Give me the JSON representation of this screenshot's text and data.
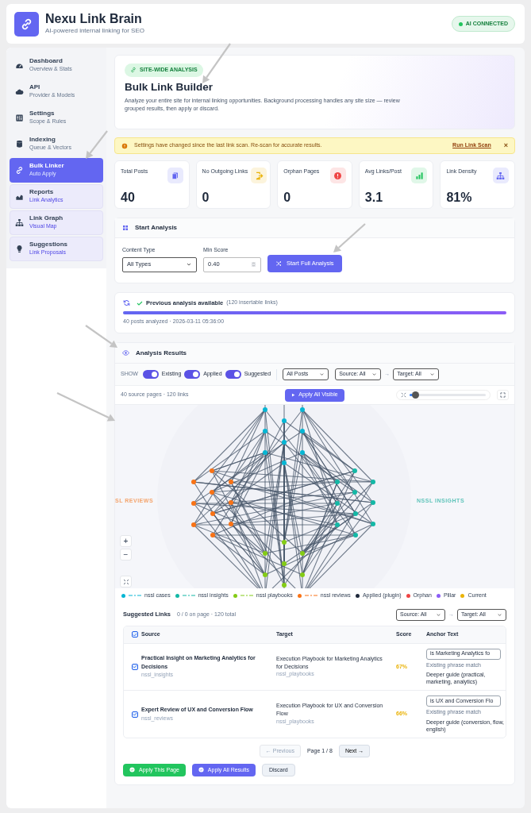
{
  "header": {
    "title": "Nexu Link Brain",
    "subtitle": "AI-powered internal linking for SEO",
    "status": "AI CONNECTED"
  },
  "sidebar": {
    "items": [
      {
        "kind": "gauge",
        "title": "Dashboard",
        "subtitle": "Overview & Stats",
        "selected": false,
        "tinted": false
      },
      {
        "kind": "cloud",
        "title": "API",
        "subtitle": "Provider & Models",
        "selected": false,
        "tinted": false
      },
      {
        "kind": "sliders",
        "title": "Settings",
        "subtitle": "Scope & Rules",
        "selected": false,
        "tinted": false
      },
      {
        "kind": "database",
        "title": "Indexing",
        "subtitle": "Queue & Vectors",
        "selected": false,
        "tinted": false
      },
      {
        "kind": "link",
        "title": "Bulk Linker",
        "subtitle": "Auto Apply",
        "selected": true,
        "tinted": false
      },
      {
        "kind": "chart",
        "title": "Reports",
        "subtitle": "Link Analytics",
        "selected": false,
        "tinted": true
      },
      {
        "kind": "sitemap",
        "title": "Link Graph",
        "subtitle": "Visual Map",
        "selected": false,
        "tinted": true
      },
      {
        "kind": "bulb",
        "title": "Suggestions",
        "subtitle": "Link Proposals",
        "selected": false,
        "tinted": true
      }
    ]
  },
  "hero": {
    "badge": "SITE-WIDE ANALYSIS",
    "title": "Bulk Link Builder",
    "description": "Analyze your entire site for internal linking opportunities. Background processing handles any site size — review grouped results, then apply or discard."
  },
  "alert": {
    "text": "Settings have changed since the last link scan. Re-scan for accurate results.",
    "action": "Run Link Scan",
    "close": "×"
  },
  "stats": [
    {
      "label": "Total Posts",
      "value": "40",
      "kind": "copy",
      "color": "#6366f1"
    },
    {
      "label": "No Outgoing Links",
      "value": "0",
      "kind": "exit",
      "color": "#eab308"
    },
    {
      "label": "Orphan Pages",
      "value": "0",
      "kind": "alert",
      "color": "#ef4444"
    },
    {
      "label": "Avg Links/Post",
      "value": "3.1",
      "kind": "bars",
      "color": "#22c55e"
    },
    {
      "label": "Link Density",
      "value": "81%",
      "kind": "sitemap",
      "color": "#6366f1"
    }
  ],
  "start_analysis": {
    "title": "Start Analysis",
    "content_type_label": "Content Type",
    "content_type": "All Types",
    "min_score_label": "Min Score",
    "min_score": "0.40",
    "button": "Start Full Analysis"
  },
  "previous": {
    "title": "Previous analysis available",
    "note": "(120 insertable links)",
    "level": 1,
    "meta": "40 posts analyzed · 2026-03-11 05:36:00"
  },
  "results": {
    "title": "Analysis Results",
    "show_label": "SHOW",
    "toggles": [
      {
        "label": "Existing",
        "on": true
      },
      {
        "label": "Applied",
        "on": true
      },
      {
        "label": "Suggested",
        "on": true
      }
    ],
    "posts_filter": "All Posts",
    "source_filter": "Source: All",
    "arrow": "→",
    "target_filter": "Target: All",
    "info": "40 source pages · 120 links",
    "apply_visible": "Apply All Visible",
    "zoom_slider": {
      "level": 0.04
    },
    "group_labels": [
      {
        "text": "SL REVIEWS",
        "color": "#f4a46c"
      },
      {
        "text": "NSSL INSIGHTS",
        "color": "#5fc4ba"
      }
    ],
    "zoom_controls": [
      "+",
      "−"
    ],
    "legend": [
      {
        "label": "nssl cases",
        "color": "#06b6d4",
        "kind": "group"
      },
      {
        "label": "nssl insights",
        "color": "#14b8a6",
        "kind": "group"
      },
      {
        "label": "nssl playbooks",
        "color": "#84cc16",
        "kind": "group"
      },
      {
        "label": "nssl reviews",
        "color": "#f97316",
        "kind": "group"
      },
      {
        "label": "Applied (plugin)",
        "color": "#1e293b",
        "kind": "status"
      },
      {
        "label": "Orphan",
        "color": "#ef4444",
        "kind": "status"
      },
      {
        "label": "Pillar",
        "color": "#8b5cf6",
        "kind": "status"
      },
      {
        "label": "Current",
        "color": "#eab308",
        "kind": "status"
      }
    ]
  },
  "suggested": {
    "title": "Suggested Links",
    "count": "0 / 0 on page · 120 total",
    "source_filter": "Source: All",
    "arrow": "→",
    "target_filter": "Target: All",
    "columns": [
      "Source",
      "Target",
      "Score",
      "Anchor Text"
    ],
    "all_checked": true,
    "rows": [
      {
        "checked": true,
        "source": "Practical Insight on Marketing Analytics for Decisions",
        "source_group": "nssl_insights",
        "target": "Execution Playbook for Marketing Analytics for Decisions",
        "target_group": "nssl_playbooks",
        "score": "67%",
        "anchor": "is Marketing Analytics fo",
        "match": "Existing phrase match",
        "reason": "Deeper guide (practical, marketing, analytics)"
      },
      {
        "checked": true,
        "source": "Expert Review of UX and Conversion Flow",
        "source_group": "nssl_reviews",
        "target": "Execution Playbook for UX and Conversion Flow",
        "target_group": "nssl_playbooks",
        "score": "66%",
        "anchor": "is UX and Conversion Flo",
        "match": "Existing phrase match",
        "reason": "Deeper guide (conversion, flow, english)"
      }
    ],
    "previous": {
      "label": "← Previous",
      "disabled": true
    },
    "page": "Page 1 / 8",
    "next": {
      "label": "Next →",
      "disabled": false
    },
    "actions": [
      {
        "label": "Apply This Page",
        "kind": "success"
      },
      {
        "label": "Apply All Results",
        "kind": "primary"
      },
      {
        "label": "Discard",
        "kind": "light"
      }
    ]
  }
}
